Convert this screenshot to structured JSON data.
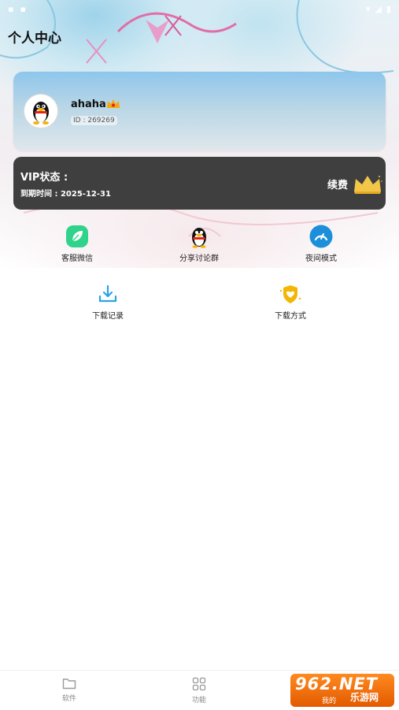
{
  "page_title": "个人中心",
  "status_bar": {
    "left_icons": [
      "wifi-icon",
      "battery-icon"
    ]
  },
  "profile": {
    "username": "ahaha",
    "user_id": "ID : 269269"
  },
  "vip": {
    "title": "VIP状态 :",
    "expire": "到期时间 : 2025-12-31",
    "renew_label": "续费"
  },
  "features_row1": [
    {
      "label": "客服微信",
      "icon": "leaf-icon",
      "color": "#2fd38a"
    },
    {
      "label": "分享讨论群",
      "icon": "penguin-icon",
      "color": "#111111"
    },
    {
      "label": "夜间模式",
      "icon": "gauge-icon",
      "color": "#1b8fd9"
    }
  ],
  "features_row2": [
    {
      "label": "下载记录",
      "icon": "download-icon",
      "color": "#2aa3e6"
    },
    {
      "label": "下载方式",
      "icon": "shield-heart-icon",
      "color": "#f2b705"
    }
  ],
  "bottom_nav": [
    {
      "label": "软件",
      "icon": "folder-icon"
    },
    {
      "label": "功能",
      "icon": "grid-icon"
    },
    {
      "label": "我的",
      "icon": "user-icon"
    }
  ],
  "watermark": {
    "big": "962.NET",
    "small": "乐游网"
  }
}
